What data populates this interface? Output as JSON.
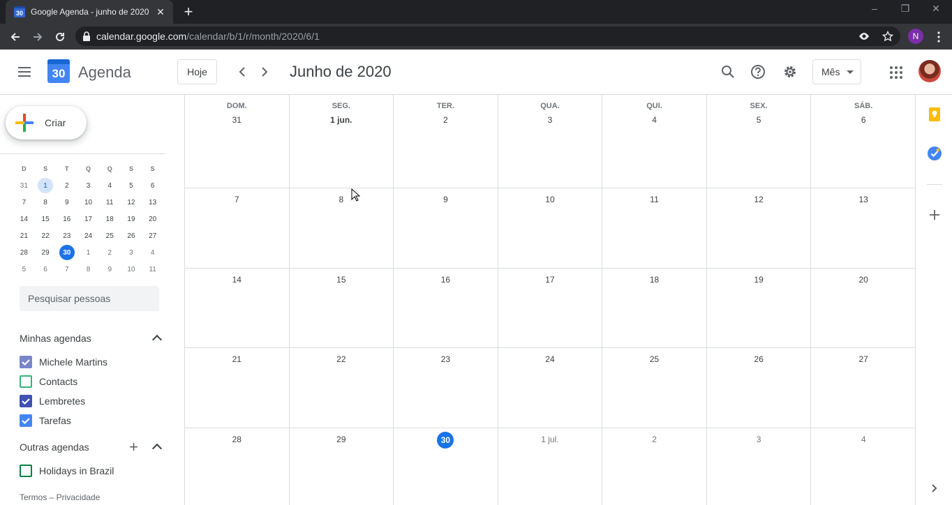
{
  "browser": {
    "tab_title": "Google Agenda - junho de 2020",
    "favicon_text": "30",
    "url_host": "calendar.google.com",
    "url_path": "/calendar/b/1/r/month/2020/6/1",
    "profile_initial": "N"
  },
  "header": {
    "app_name": "Agenda",
    "logo_text": "30",
    "today_label": "Hoje",
    "month_title": "Junho de 2020",
    "view_label": "Mês"
  },
  "sidebar": {
    "create_label": "Criar",
    "people_search_placeholder": "Pesquisar pessoas",
    "my_calendars_title": "Minhas agendas",
    "other_calendars_title": "Outras agendas",
    "my_calendars": [
      {
        "label": "Michele Martins",
        "color": "#7986cb",
        "checked": true
      },
      {
        "label": "Contacts",
        "color": "#33b679",
        "checked": false
      },
      {
        "label": "Lembretes",
        "color": "#3f51b5",
        "checked": true
      },
      {
        "label": "Tarefas",
        "color": "#4285f4",
        "checked": true
      }
    ],
    "other_calendars": [
      {
        "label": "Holidays in Brazil",
        "color": "#0b8043",
        "checked": false
      }
    ],
    "footer": "Termos – Privacidade"
  },
  "mini_calendar": {
    "weekdays": [
      "D",
      "S",
      "T",
      "Q",
      "Q",
      "S",
      "S"
    ],
    "weeks": [
      [
        "31",
        "1",
        "2",
        "3",
        "4",
        "5",
        "6"
      ],
      [
        "7",
        "8",
        "9",
        "10",
        "11",
        "12",
        "13"
      ],
      [
        "14",
        "15",
        "16",
        "17",
        "18",
        "19",
        "20"
      ],
      [
        "21",
        "22",
        "23",
        "24",
        "25",
        "26",
        "27"
      ],
      [
        "28",
        "29",
        "30",
        "1",
        "2",
        "3",
        "4"
      ],
      [
        "5",
        "6",
        "7",
        "8",
        "9",
        "10",
        "11"
      ]
    ]
  },
  "month_grid": {
    "weekdays": [
      "DOM.",
      "SEG.",
      "TER.",
      "QUA.",
      "QUI.",
      "SEX.",
      "SÁB."
    ],
    "weeks": [
      [
        "31",
        "1 jun.",
        "2",
        "3",
        "4",
        "5",
        "6"
      ],
      [
        "7",
        "8",
        "9",
        "10",
        "11",
        "12",
        "13"
      ],
      [
        "14",
        "15",
        "16",
        "17",
        "18",
        "19",
        "20"
      ],
      [
        "21",
        "22",
        "23",
        "24",
        "25",
        "26",
        "27"
      ],
      [
        "28",
        "29",
        "30",
        "1 jul.",
        "2",
        "3",
        "4"
      ]
    ],
    "today": "30"
  },
  "colors": {
    "accent": "#1a73e8",
    "keep": "#fbbc04",
    "tasks": "#4285f4"
  }
}
